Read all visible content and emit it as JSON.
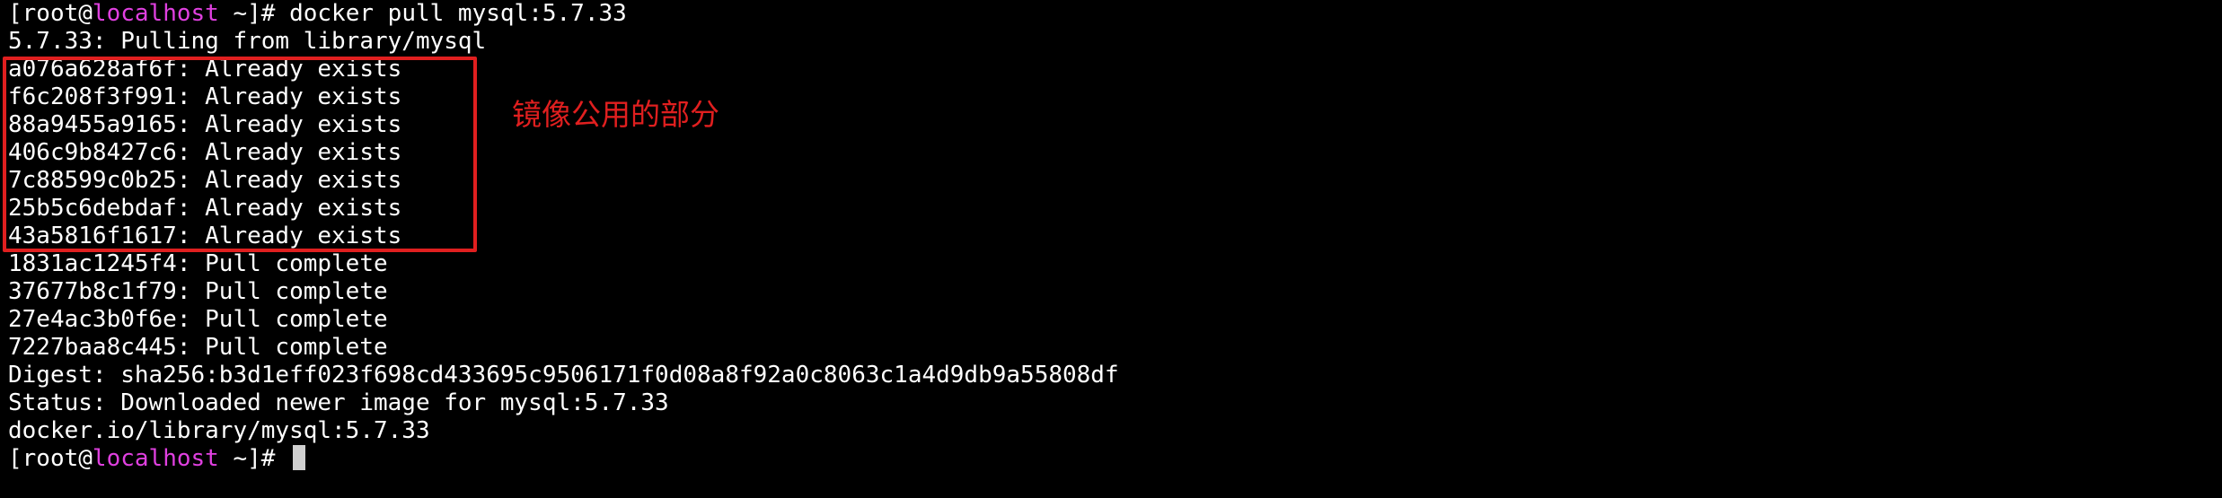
{
  "terminal": {
    "prompt": {
      "user": "[root@",
      "host": "localhost",
      "suffix": " ~]# "
    },
    "command": "docker pull mysql:5.7.33",
    "output_lines": [
      "5.7.33: Pulling from library/mysql",
      "a076a628af6f: Already exists",
      "f6c208f3f991: Already exists",
      "88a9455a9165: Already exists",
      "406c9b8427c6: Already exists",
      "7c88599c0b25: Already exists",
      "25b5c6debdaf: Already exists",
      "43a5816f1617: Already exists",
      "1831ac1245f4: Pull complete",
      "37677b8c1f79: Pull complete",
      "27e4ac3b0f6e: Pull complete",
      "7227baa8c445: Pull complete",
      "Digest: sha256:b3d1eff023f698cd433695c9506171f0d08a8f92a0c8063c1a4d9db9a55808df",
      "Status: Downloaded newer image for mysql:5.7.33",
      "docker.io/library/mysql:5.7.33"
    ],
    "final_prompt": {
      "user": "[root@",
      "host": "localhost",
      "suffix": " ~]# "
    }
  },
  "annotation": {
    "text": "镜像公用的部分",
    "color": "#e01f1f"
  },
  "colors": {
    "background": "#000000",
    "text": "#ffffff",
    "host": "#e040e0",
    "highlight": "#e01f1f"
  }
}
